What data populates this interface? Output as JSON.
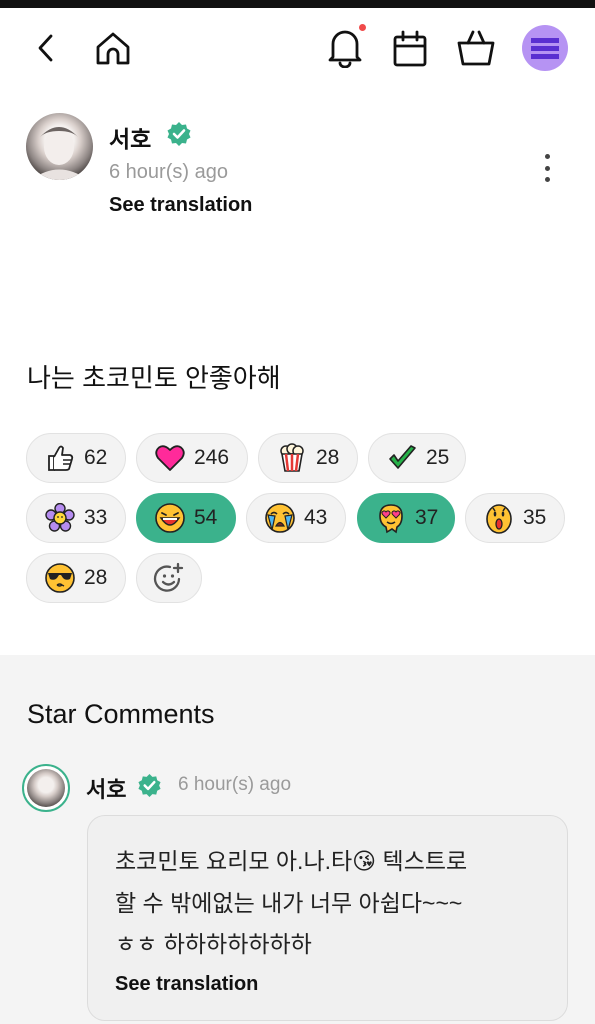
{
  "colors": {
    "accent": "#3bb28c",
    "menu_bg": "#b693f3",
    "notification_dot": "#f04a4a",
    "muted_text": "#9a9a9a"
  },
  "nav": {
    "icons": [
      "back-arrow-icon",
      "home-icon",
      "bell-icon",
      "calendar-icon",
      "shopping-bag-icon",
      "menu-icon"
    ],
    "has_notification": true
  },
  "post": {
    "author": "서호",
    "verified": true,
    "time": "6 hour(s) ago",
    "see_translation": "See translation",
    "body": "나는 초코민토 안좋아해"
  },
  "reactions": [
    {
      "icon": "thumbs-up-icon",
      "count": "62",
      "selected": false
    },
    {
      "icon": "heart-icon",
      "count": "246",
      "selected": false
    },
    {
      "icon": "popcorn-icon",
      "count": "28",
      "selected": false
    },
    {
      "icon": "checkmark-icon",
      "count": "25",
      "selected": false
    },
    {
      "icon": "flower-icon",
      "count": "33",
      "selected": false
    },
    {
      "icon": "laughing-face-icon",
      "count": "54",
      "selected": true
    },
    {
      "icon": "crying-face-icon",
      "count": "43",
      "selected": false
    },
    {
      "icon": "heart-eyes-face-icon",
      "count": "37",
      "selected": true
    },
    {
      "icon": "surprised-face-icon",
      "count": "35",
      "selected": false
    },
    {
      "icon": "sunglasses-kiss-face-icon",
      "count": "28",
      "selected": false
    }
  ],
  "comments": {
    "title": "Star Comments",
    "items": [
      {
        "author": "서호",
        "verified": true,
        "time": "6 hour(s) ago",
        "lines": [
          "초코민토 요리모 아.나.타😘 텍스트로",
          "할 수 밖에없는 내가 너무 아쉽다~~~",
          "ㅎㅎ 하하하하하하하"
        ],
        "see_translation": "See translation"
      }
    ]
  }
}
